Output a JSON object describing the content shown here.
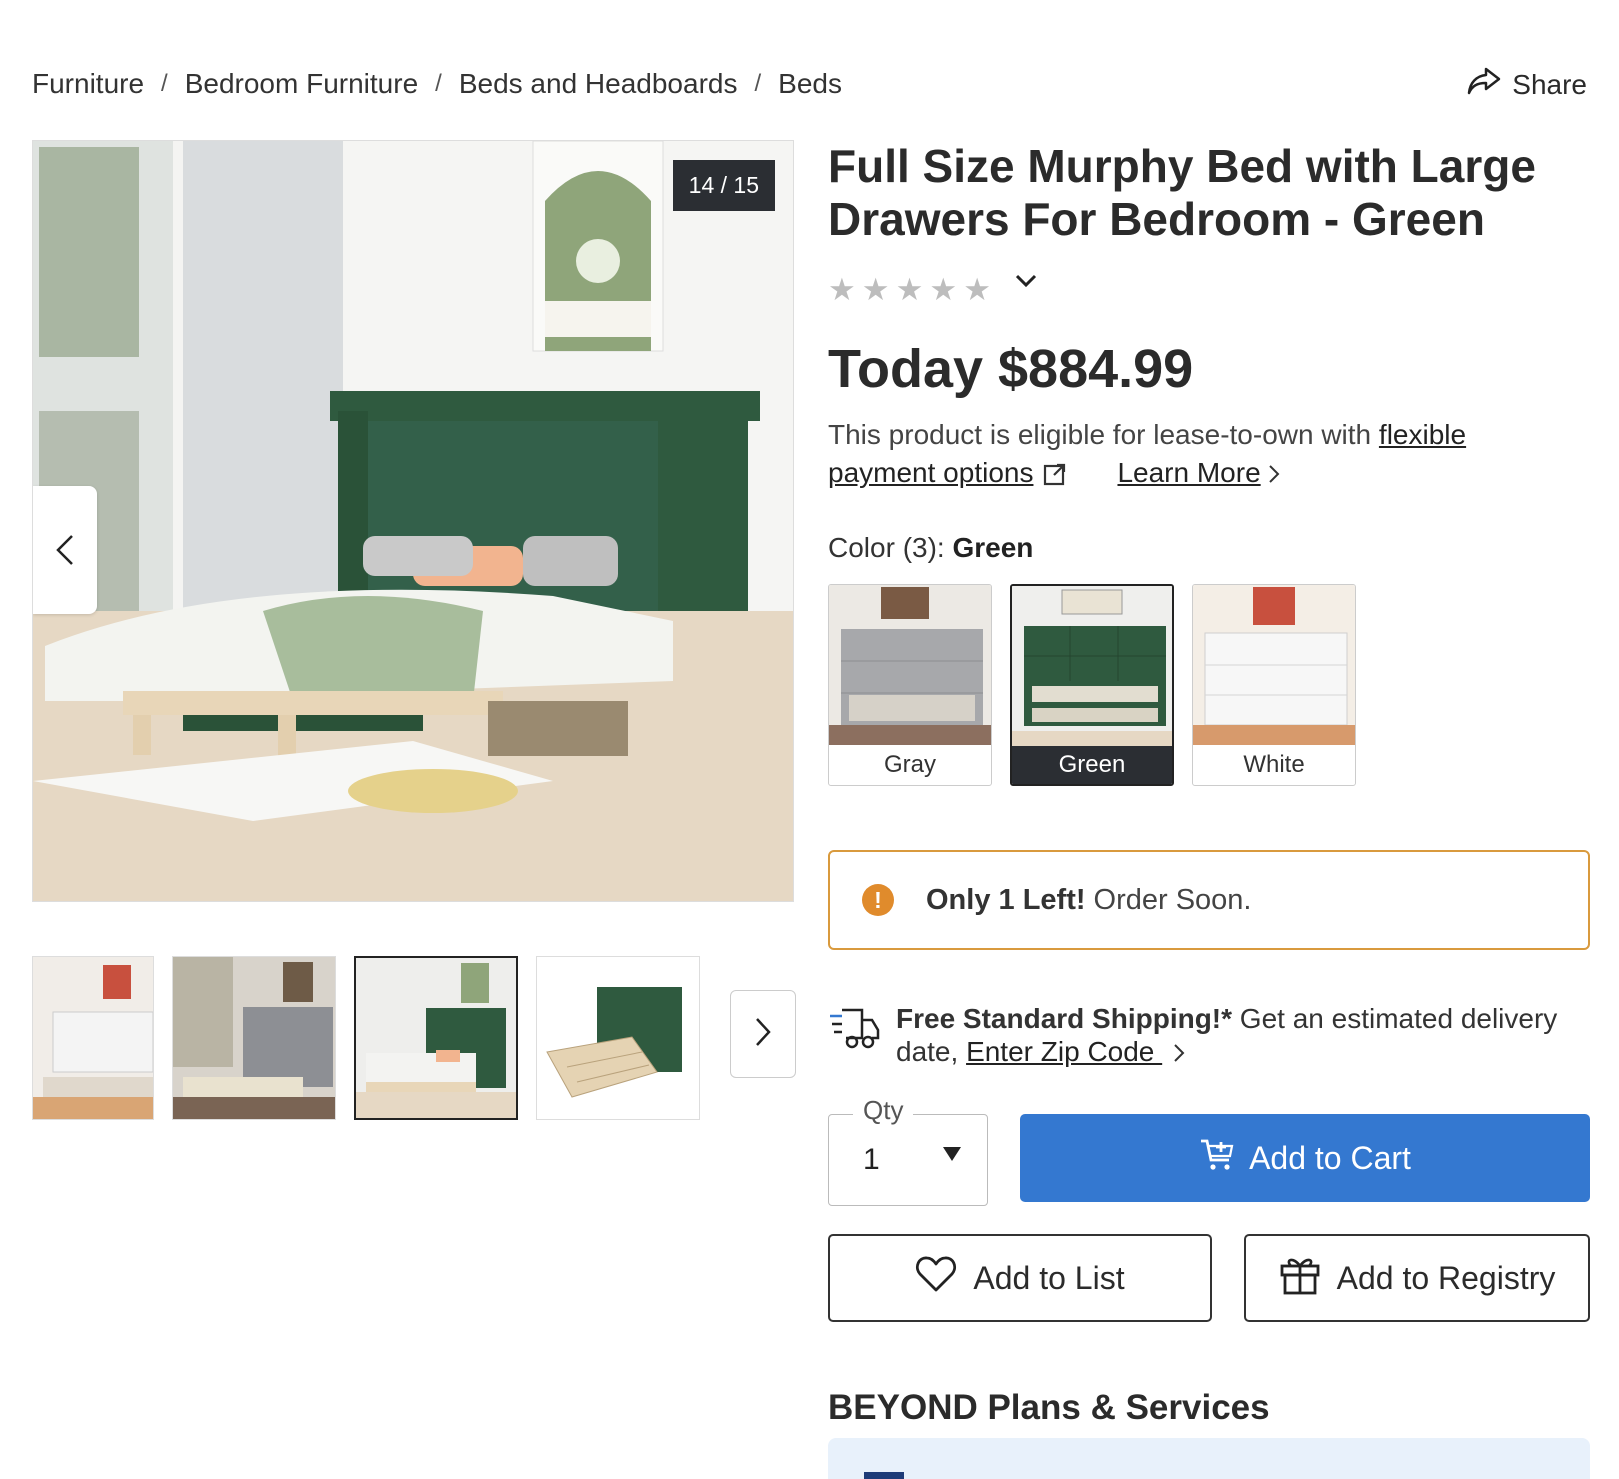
{
  "breadcrumb": {
    "items": [
      "Furniture",
      "Bedroom Furniture",
      "Beds and Headboards",
      "Beds"
    ],
    "separator": "/"
  },
  "share": {
    "label": "Share",
    "icon": "share-arrow-icon"
  },
  "gallery": {
    "counter": "14 / 15",
    "active_thumb_index": 2,
    "thumbnail_count_visible": 4
  },
  "product": {
    "title": "Full Size Murphy Bed with Large Drawers For Bedroom - Green",
    "rating_stars": 0,
    "price": "Today $884.99",
    "lease_text": "This product is eligible for lease-to-own with ",
    "lease_link": "flexible payment options",
    "learn_more": "Learn More"
  },
  "color": {
    "label": "Color (3): ",
    "selected": "Green",
    "options": [
      "Gray",
      "Green",
      "White"
    ]
  },
  "stock": {
    "bold": "Only 1 Left!",
    "text": "Order Soon."
  },
  "shipping": {
    "bold": "Free Standard Shipping!*",
    "text": " Get an estimated delivery date, ",
    "link": "Enter Zip Code "
  },
  "qty": {
    "label": "Qty",
    "value": "1"
  },
  "actions": {
    "add_to_cart": "Add to Cart",
    "add_to_list": "Add to List",
    "add_to_registry": "Add to Registry"
  },
  "beyond": {
    "title": "BEYOND Plans & Services"
  },
  "colors": {
    "accent_blue": "#3478d0",
    "stock_border": "#d99a3d",
    "warn_orange": "#e08b2c",
    "bed_green": "#2f5a3f",
    "dark": "#2b2e33"
  }
}
